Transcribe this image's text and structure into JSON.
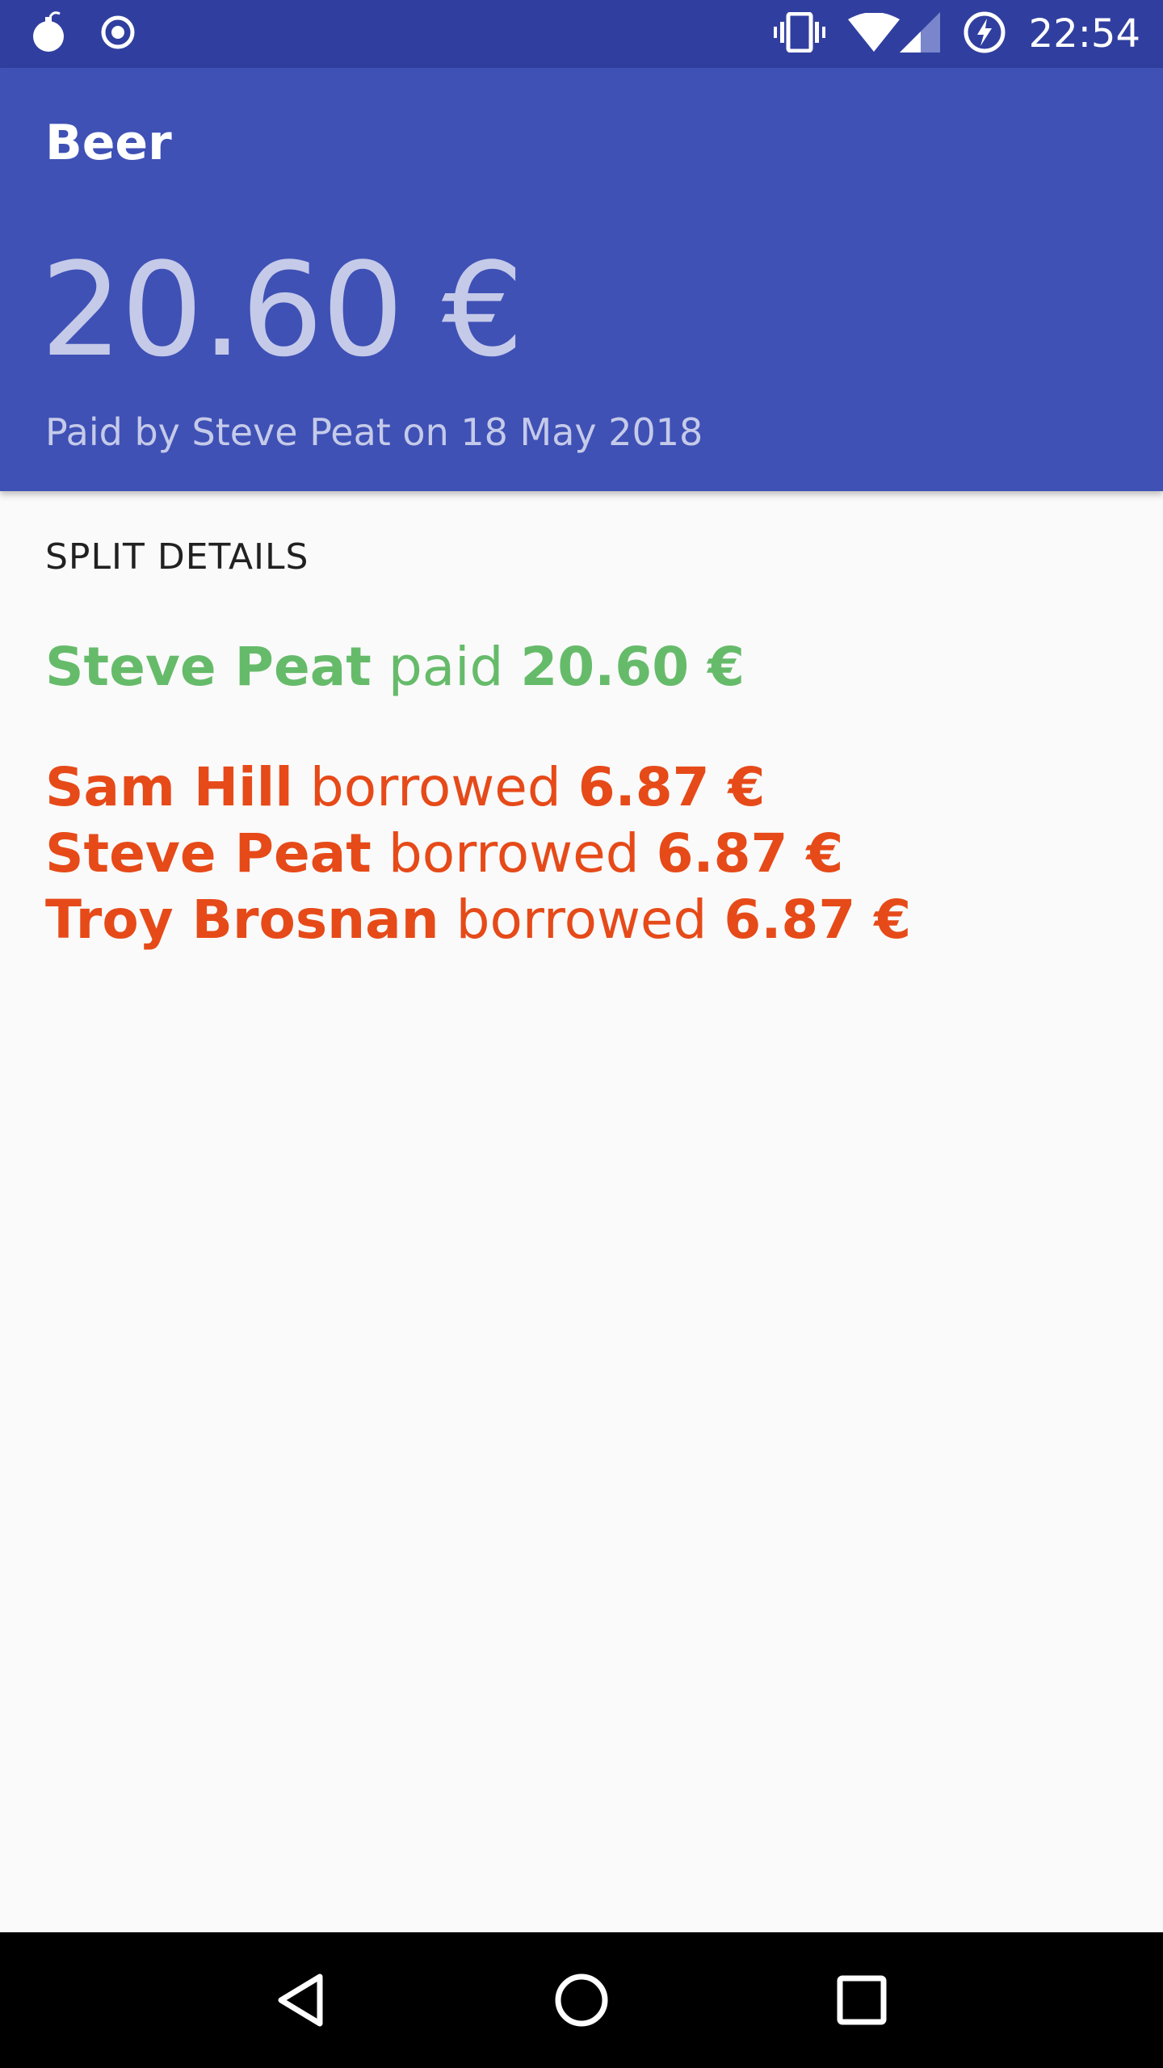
{
  "status_bar": {
    "time": "22:54",
    "icons_left": [
      "bomb-icon",
      "target-icon"
    ],
    "icons_right": [
      "vibrate-icon",
      "wifi-icon",
      "signal-icon",
      "battery-charging-icon"
    ]
  },
  "expense": {
    "title": "Beer",
    "amount": "20.60 €",
    "subtitle": "Paid by Steve Peat on 18 May 2018"
  },
  "split": {
    "header": "SPLIT DETAILS",
    "payer": {
      "name": "Steve Peat",
      "verb": " paid ",
      "amount": "20.60 €"
    },
    "borrowers": [
      {
        "name": "Sam Hill",
        "verb": " borrowed ",
        "amount": "6.87 €"
      },
      {
        "name": "Steve Peat",
        "verb": " borrowed ",
        "amount": "6.87 €"
      },
      {
        "name": "Troy Brosnan",
        "verb": " borrowed ",
        "amount": "6.87 €"
      }
    ]
  },
  "nav": {
    "buttons": [
      "back-icon",
      "home-icon",
      "recents-icon"
    ]
  },
  "colors": {
    "status_bar": "#303f9f",
    "app_bar": "#3f51b5",
    "paid": "#66bb6a",
    "borrowed": "#e64a19"
  }
}
